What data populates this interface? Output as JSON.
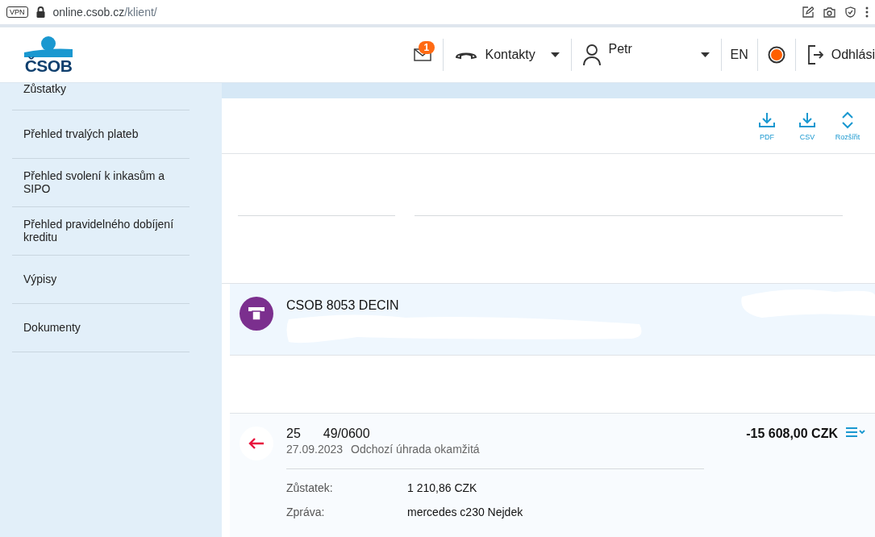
{
  "browser": {
    "vpn_label": "VPN",
    "url_host": "online.csob.cz",
    "url_path": "/klient/"
  },
  "header": {
    "logo_text": "ČSOB",
    "messages_badge": "1",
    "contacts": "Kontakty",
    "user": "Petr",
    "language": "EN",
    "logout": "Odhlási"
  },
  "sidebar": {
    "items": [
      {
        "label": "Zůstatky",
        "selected": false
      },
      {
        "label": "Přehled trvalých plateb",
        "selected": false
      },
      {
        "label": "Přehled svolení k inkasům a SIPO",
        "selected": false
      },
      {
        "label": "Přehled pravidelného dobíjení kreditu",
        "selected": false
      },
      {
        "label": "Výpisy",
        "selected": false
      },
      {
        "label": "Dokumenty",
        "selected": false
      }
    ]
  },
  "toolbar": [
    {
      "kind": "download",
      "label": "PDF"
    },
    {
      "kind": "download",
      "label": "CSV"
    },
    {
      "kind": "expand",
      "label": "Rozšířit"
    }
  ],
  "atm_row": {
    "title": "CSOB 8053 DECIN"
  },
  "transaction": {
    "account_start": "25",
    "account_end": "49/0600",
    "date": "27.09.2023",
    "type": "Odchozí úhrada okamžitá",
    "amount": "-15 608,00 CZK",
    "details": [
      {
        "label": "Zůstatek:",
        "value": "1 210,86 CZK"
      },
      {
        "label": "Zpráva:",
        "value": "mercedes c230 Nejdek"
      }
    ]
  }
}
